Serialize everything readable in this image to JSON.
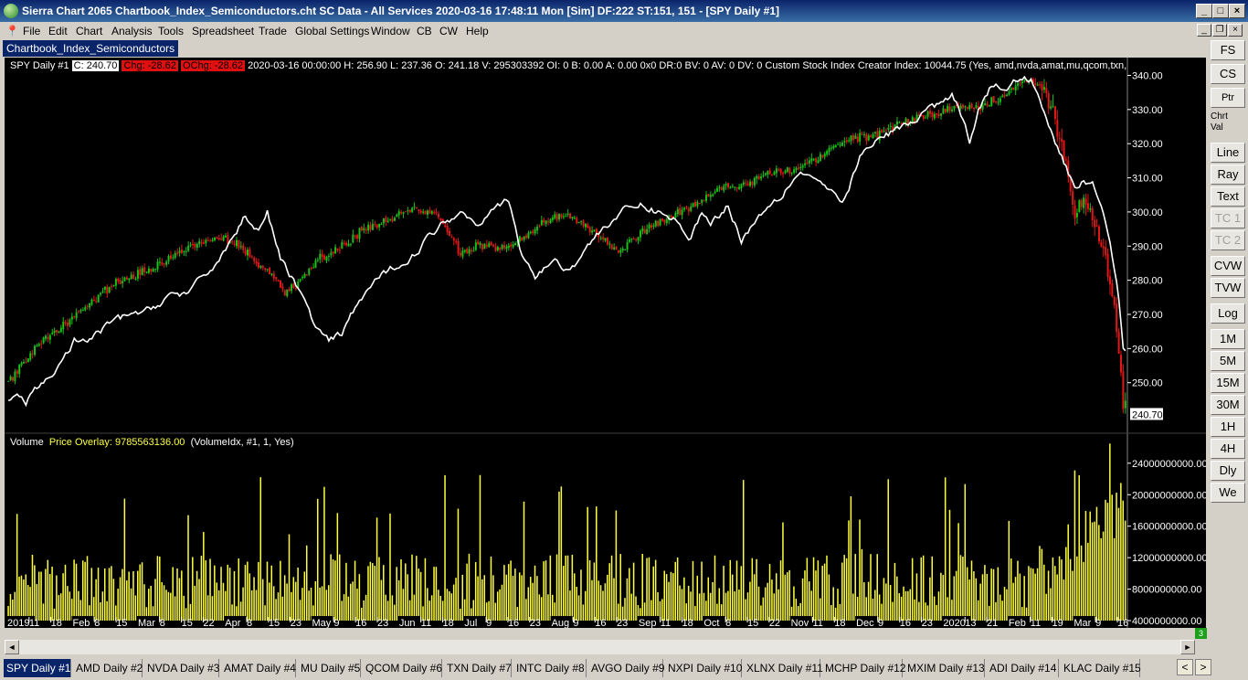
{
  "window": {
    "title": "Sierra Chart 2065 Chartbook_Index_Semiconductors.cht  SC Data - All Services 2020-03-16  17:48:11 Mon [Sim]  DF:222  ST:151, 151 - [SPY  Daily  #1]",
    "minimize": "_",
    "maximize": "□",
    "close": "×"
  },
  "menu": [
    "File",
    "Edit",
    "Chart",
    "Analysis",
    "Tools",
    "Spreadsheet",
    "Trade",
    "Global Settings",
    "Window",
    "CB",
    "CW",
    "Help"
  ],
  "mdi": {
    "minimize": "_",
    "restore": "❐",
    "close": "×"
  },
  "chartbook_tab": "Chartbook_Index_Semiconductors",
  "chart_header": {
    "symbol": "SPY  Daily  #1",
    "close_chip": "C: 240.70",
    "chg_chip": "Chg: -28.62",
    "ochg_chip": "OChg: -28.62",
    "rest": "2020-03-16 00:00:00 H: 256.90  L: 237.36  O: 241.18  V: 295303392  OI: 0  B: 0.00  A: 0.00  0x0  DR:0  BV: 0  AV: 0  DV: 0  Custom Stock Index Creator  Index: 10044.75  (Yes, amd,nvda,amat,mu,qcom,txn,"
  },
  "volume_header": {
    "name": "Volume",
    "overlay": "Price Overlay: 9785563136.00",
    "params": "(VolumeIdx, #1, 1, Yes)"
  },
  "price_axis": [
    "340.00",
    "330.00",
    "320.00",
    "310.00",
    "300.00",
    "290.00",
    "280.00",
    "270.00",
    "260.00",
    "250.00"
  ],
  "last_price_label": "240.70",
  "volume_axis": [
    "24000000000.00",
    "20000000000.00",
    "16000000000.00",
    "12000000000.00",
    "8000000000.00",
    "4000000000.00"
  ],
  "date_axis": [
    {
      "t": "2019",
      "m": true
    },
    {
      "t": "11"
    },
    {
      "t": "18"
    },
    {
      "t": "Feb",
      "m": true
    },
    {
      "t": "8"
    },
    {
      "t": "15"
    },
    {
      "t": "Mar",
      "m": true
    },
    {
      "t": "8"
    },
    {
      "t": "15"
    },
    {
      "t": "22"
    },
    {
      "t": "Apr",
      "m": true
    },
    {
      "t": "8"
    },
    {
      "t": "15"
    },
    {
      "t": "23"
    },
    {
      "t": "May",
      "m": true
    },
    {
      "t": "9"
    },
    {
      "t": "16"
    },
    {
      "t": "23"
    },
    {
      "t": "Jun",
      "m": true
    },
    {
      "t": "11"
    },
    {
      "t": "18"
    },
    {
      "t": "Jul",
      "m": true
    },
    {
      "t": "9"
    },
    {
      "t": "16"
    },
    {
      "t": "23"
    },
    {
      "t": "Aug",
      "m": true
    },
    {
      "t": "9"
    },
    {
      "t": "16"
    },
    {
      "t": "23"
    },
    {
      "t": "Sep",
      "m": true
    },
    {
      "t": "11"
    },
    {
      "t": "18"
    },
    {
      "t": "Oct",
      "m": true
    },
    {
      "t": "8"
    },
    {
      "t": "15"
    },
    {
      "t": "22"
    },
    {
      "t": "Nov",
      "m": true
    },
    {
      "t": "11"
    },
    {
      "t": "18"
    },
    {
      "t": "Dec",
      "m": true
    },
    {
      "t": "9"
    },
    {
      "t": "16"
    },
    {
      "t": "23"
    },
    {
      "t": "2020",
      "m": true
    },
    {
      "t": "13"
    },
    {
      "t": "21"
    },
    {
      "t": "Feb",
      "m": true
    },
    {
      "t": "11"
    },
    {
      "t": "19"
    },
    {
      "t": "Mar",
      "m": true
    },
    {
      "t": "9"
    },
    {
      "t": "16"
    }
  ],
  "toolbar": [
    {
      "label": "FS"
    },
    {
      "label": "CS"
    },
    {
      "label": "Ptr",
      "small": true
    },
    {
      "label": "Chrt Val",
      "text": true
    },
    {
      "label": "Line"
    },
    {
      "label": "Ray"
    },
    {
      "label": "Text"
    },
    {
      "label": "TC 1",
      "disabled": true
    },
    {
      "label": "TC 2",
      "disabled": true
    },
    {
      "label": "CVW"
    },
    {
      "label": "TVW"
    },
    {
      "label": "Log"
    },
    {
      "label": "1M"
    },
    {
      "label": "5M"
    },
    {
      "label": "15M"
    },
    {
      "label": "30M"
    },
    {
      "label": "1H"
    },
    {
      "label": "4H"
    },
    {
      "label": "Dly"
    },
    {
      "label": "We"
    }
  ],
  "green_indicator": "3",
  "scroll": {
    "left": "◄",
    "right": "►"
  },
  "tabs": [
    "SPY  Daily  #1",
    "AMD  Daily  #2",
    "NVDA  Daily  #3",
    "AMAT  Daily  #4",
    "MU  Daily  #5",
    "QCOM  Daily  #6",
    "TXN  Daily  #7",
    "INTC  Daily  #8",
    "AVGO  Daily  #9",
    "NXPI  Daily  #10",
    "XLNX  Daily  #11",
    "MCHP  Daily  #12",
    "MXIM  Daily  #13",
    "ADI  Daily  #14",
    "KLAC  Daily  #15"
  ],
  "tab_nav": {
    "prev": "<",
    "next": ">"
  },
  "colors": {
    "up": "#18c018",
    "down": "#e01818",
    "overlay": "#ffffff",
    "volume": "#ffff40",
    "background": "#000000",
    "axis_text": "#ffffff"
  },
  "chart_data": {
    "type": "candlestick",
    "symbol": "SPY",
    "period": "2019-01-02 to 2020-03-16",
    "ylim": [
      236,
      342
    ],
    "price_anchors": [
      [
        0,
        250
      ],
      [
        6,
        255
      ],
      [
        14,
        262
      ],
      [
        24,
        266
      ],
      [
        34,
        272
      ],
      [
        44,
        277
      ],
      [
        54,
        281
      ],
      [
        64,
        283
      ],
      [
        76,
        288
      ],
      [
        86,
        291
      ],
      [
        96,
        293
      ],
      [
        104,
        291
      ],
      [
        112,
        286
      ],
      [
        120,
        282
      ],
      [
        126,
        276
      ],
      [
        132,
        279
      ],
      [
        140,
        286
      ],
      [
        150,
        289
      ],
      [
        160,
        294
      ],
      [
        168,
        296
      ],
      [
        176,
        299
      ],
      [
        184,
        301
      ],
      [
        196,
        299
      ],
      [
        206,
        288
      ],
      [
        214,
        290
      ],
      [
        226,
        290
      ],
      [
        236,
        293
      ],
      [
        244,
        297
      ],
      [
        252,
        299
      ],
      [
        260,
        297
      ],
      [
        270,
        293
      ],
      [
        278,
        288
      ],
      [
        286,
        293
      ],
      [
        296,
        297
      ],
      [
        306,
        300
      ],
      [
        316,
        303
      ],
      [
        326,
        307
      ],
      [
        336,
        308
      ],
      [
        346,
        311
      ],
      [
        354,
        312
      ],
      [
        364,
        314
      ],
      [
        374,
        318
      ],
      [
        384,
        322
      ],
      [
        394,
        322
      ],
      [
        404,
        325
      ],
      [
        414,
        328
      ],
      [
        424,
        329
      ],
      [
        432,
        331
      ],
      [
        440,
        330
      ],
      [
        450,
        333
      ],
      [
        458,
        336
      ],
      [
        466,
        339
      ],
      [
        472,
        336
      ],
      [
        476,
        328
      ],
      [
        482,
        314
      ],
      [
        486,
        298
      ],
      [
        490,
        305
      ],
      [
        494,
        299
      ],
      [
        498,
        290
      ],
      [
        502,
        280
      ],
      [
        504,
        272
      ],
      [
        506,
        260
      ],
      [
        508,
        243
      ]
    ],
    "index_anchors": [
      [
        0,
        245
      ],
      [
        4,
        247
      ],
      [
        8,
        243
      ],
      [
        12,
        248
      ],
      [
        16,
        250
      ],
      [
        22,
        254
      ],
      [
        30,
        262
      ],
      [
        36,
        262
      ],
      [
        42,
        265
      ],
      [
        48,
        268
      ],
      [
        56,
        270
      ],
      [
        64,
        271
      ],
      [
        74,
        276
      ],
      [
        82,
        276
      ],
      [
        92,
        283
      ],
      [
        100,
        290
      ],
      [
        108,
        299
      ],
      [
        114,
        295
      ],
      [
        118,
        300
      ],
      [
        124,
        286
      ],
      [
        132,
        278
      ],
      [
        140,
        266
      ],
      [
        146,
        262
      ],
      [
        152,
        264
      ],
      [
        158,
        272
      ],
      [
        166,
        279
      ],
      [
        176,
        284
      ],
      [
        184,
        287
      ],
      [
        192,
        293
      ],
      [
        200,
        298
      ],
      [
        208,
        300
      ],
      [
        214,
        296
      ],
      [
        220,
        302
      ],
      [
        228,
        303
      ],
      [
        234,
        287
      ],
      [
        240,
        281
      ],
      [
        248,
        286
      ],
      [
        256,
        283
      ],
      [
        264,
        290
      ],
      [
        272,
        296
      ],
      [
        280,
        300
      ],
      [
        288,
        302
      ],
      [
        296,
        300
      ],
      [
        304,
        298
      ],
      [
        310,
        291
      ],
      [
        316,
        300
      ],
      [
        320,
        297
      ],
      [
        328,
        302
      ],
      [
        334,
        292
      ],
      [
        340,
        297
      ],
      [
        346,
        302
      ],
      [
        352,
        305
      ],
      [
        360,
        312
      ],
      [
        368,
        310
      ],
      [
        374,
        306
      ],
      [
        380,
        302
      ],
      [
        388,
        316
      ],
      [
        396,
        321
      ],
      [
        404,
        324
      ],
      [
        412,
        326
      ],
      [
        420,
        331
      ],
      [
        426,
        331
      ],
      [
        430,
        335
      ],
      [
        436,
        326
      ],
      [
        438,
        321
      ],
      [
        442,
        330
      ],
      [
        448,
        337
      ],
      [
        454,
        336
      ],
      [
        460,
        339
      ],
      [
        466,
        339
      ],
      [
        472,
        330
      ],
      [
        478,
        319
      ],
      [
        482,
        313
      ],
      [
        486,
        306
      ],
      [
        490,
        310
      ],
      [
        494,
        308
      ],
      [
        498,
        303
      ],
      [
        502,
        292
      ],
      [
        506,
        275
      ],
      [
        508,
        260
      ]
    ],
    "volume_range": [
      4000000000,
      27000000000
    ],
    "num_bars": 510
  }
}
